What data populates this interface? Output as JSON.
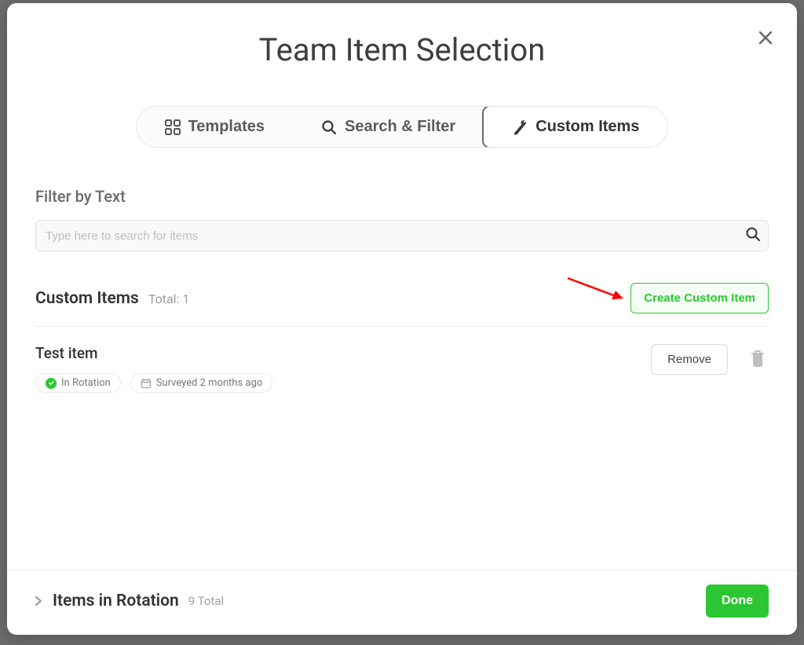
{
  "modal": {
    "title": "Team Item Selection",
    "tabs": {
      "templates": "Templates",
      "search_filter": "Search & Filter",
      "custom_items": "Custom Items"
    },
    "filter": {
      "label": "Filter by Text",
      "placeholder": "Type here to search for items"
    },
    "custom_items_header": {
      "title": "Custom Items",
      "total_label": "Total: 1",
      "create_button": "Create Custom Item"
    },
    "item": {
      "title": "Test item",
      "chip_rotation": "In Rotation",
      "chip_surveyed": "Surveyed 2 months ago",
      "remove_label": "Remove"
    },
    "footer": {
      "title": "Items in Rotation",
      "subtitle": "9 Total",
      "done_label": "Done"
    }
  }
}
